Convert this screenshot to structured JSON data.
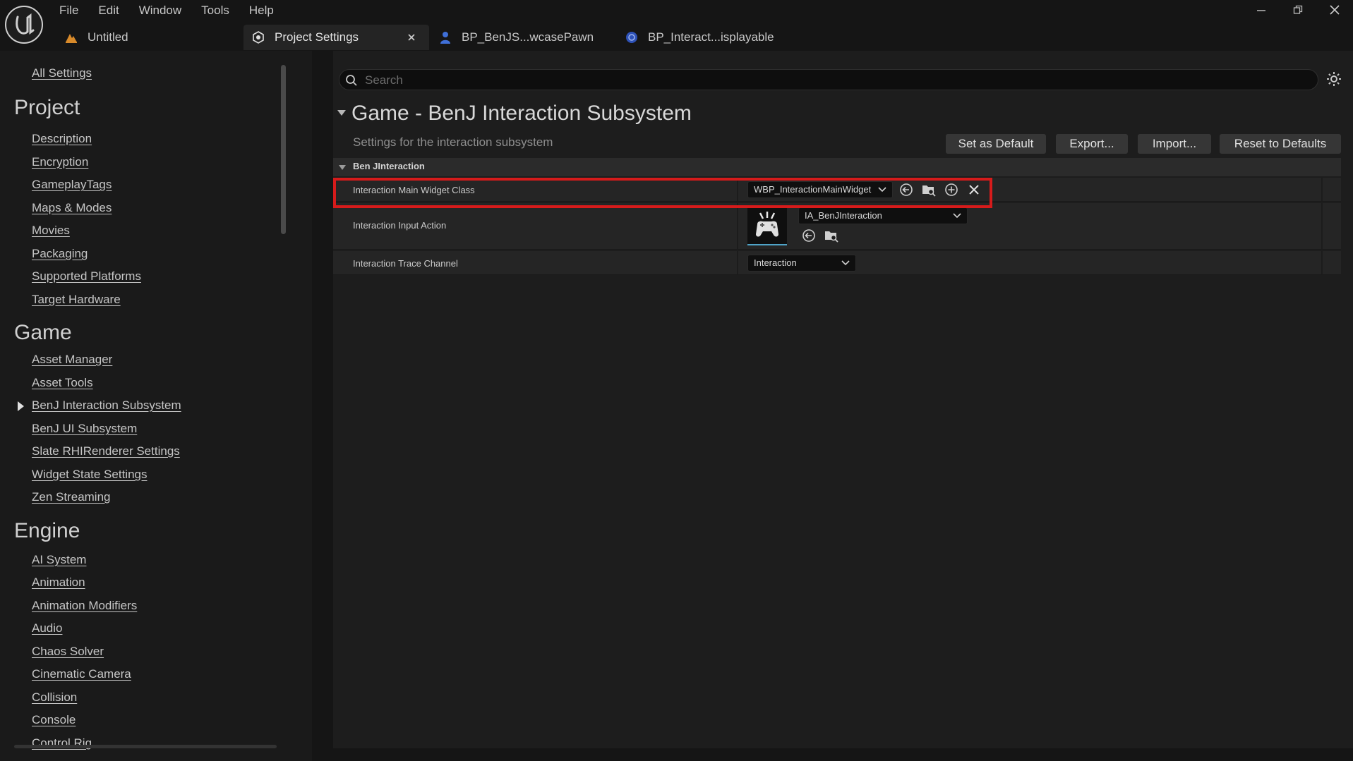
{
  "window": {
    "menu": [
      "File",
      "Edit",
      "Window",
      "Tools",
      "Help"
    ],
    "tabs": [
      {
        "label": "Untitled",
        "icon": "level-icon"
      },
      {
        "label": "Project Settings",
        "icon": "settings-cube-icon"
      },
      {
        "label": "BP_BenJS...wcasePawn",
        "icon": "pawn-icon"
      },
      {
        "label": "BP_Interact...isplayable",
        "icon": "blueprint-icon"
      }
    ]
  },
  "sidebar": {
    "all_settings": "All Settings",
    "sections": [
      {
        "title": "Project",
        "items": [
          "Description",
          "Encryption",
          "GameplayTags",
          "Maps & Modes",
          "Movies",
          "Packaging",
          "Supported Platforms",
          "Target Hardware"
        ]
      },
      {
        "title": "Game",
        "items": [
          "Asset Manager",
          "Asset Tools",
          "BenJ Interaction Subsystem",
          "BenJ UI Subsystem",
          "Slate RHIRenderer Settings",
          "Widget State Settings",
          "Zen Streaming"
        ]
      },
      {
        "title": "Engine",
        "items": [
          "AI System",
          "Animation",
          "Animation Modifiers",
          "Audio",
          "Chaos Solver",
          "Cinematic Camera",
          "Collision",
          "Console",
          "Control Rig"
        ]
      }
    ],
    "active_item": "BenJ Interaction Subsystem"
  },
  "search": {
    "placeholder": "Search",
    "value": ""
  },
  "section": {
    "title": "Game - BenJ Interaction Subsystem",
    "description": "Settings for the interaction subsystem",
    "buttons": {
      "set_default": "Set as Default",
      "export": "Export...",
      "import": "Import...",
      "reset": "Reset to Defaults"
    }
  },
  "category": {
    "label": "Ben JInteraction",
    "properties": [
      {
        "label": "Interaction Main Widget Class",
        "value": "WBP_InteractionMainWidget"
      },
      {
        "label": "Interaction Input Action",
        "value": "IA_BenJInteraction"
      },
      {
        "label": "Interaction Trace Channel",
        "value": "Interaction"
      }
    ]
  },
  "colors": {
    "highlight": "#d61b1b",
    "accent": "#4fa3c7",
    "background": "#151515"
  }
}
